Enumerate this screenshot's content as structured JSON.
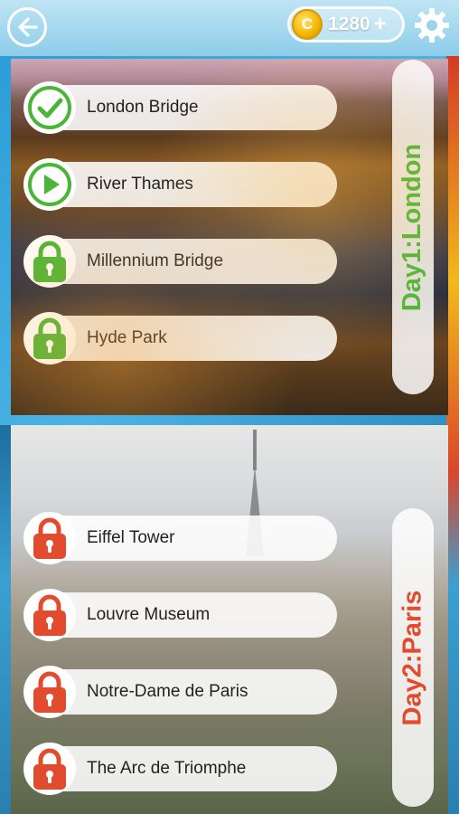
{
  "topbar": {
    "back_icon": "arrow-left-icon",
    "coin_count": "1280",
    "coin_plus": "+",
    "coin_glyph": "C",
    "settings_icon": "gear-icon"
  },
  "days": [
    {
      "title": "Day1:London",
      "title_color": "#4ab536",
      "levels": [
        {
          "label": "London Bridge",
          "status": "completed",
          "icon": "check-icon"
        },
        {
          "label": "River Thames",
          "status": "current",
          "icon": "play-icon"
        },
        {
          "label": "Millennium Bridge",
          "status": "locked",
          "icon": "lock-icon"
        },
        {
          "label": "Hyde Park",
          "status": "locked",
          "icon": "lock-icon"
        }
      ]
    },
    {
      "title": "Day2:Paris",
      "title_color": "#e24b2e",
      "levels": [
        {
          "label": "Eiffel Tower",
          "status": "locked",
          "icon": "lock-icon"
        },
        {
          "label": "Louvre Museum",
          "status": "locked",
          "icon": "lock-icon"
        },
        {
          "label": "Notre-Dame de Paris",
          "status": "locked",
          "icon": "lock-icon"
        },
        {
          "label": "The Arc de Triomphe",
          "status": "locked",
          "icon": "lock-icon"
        }
      ]
    }
  ],
  "colors": {
    "green": "#4ab536",
    "red": "#e24b2e"
  }
}
